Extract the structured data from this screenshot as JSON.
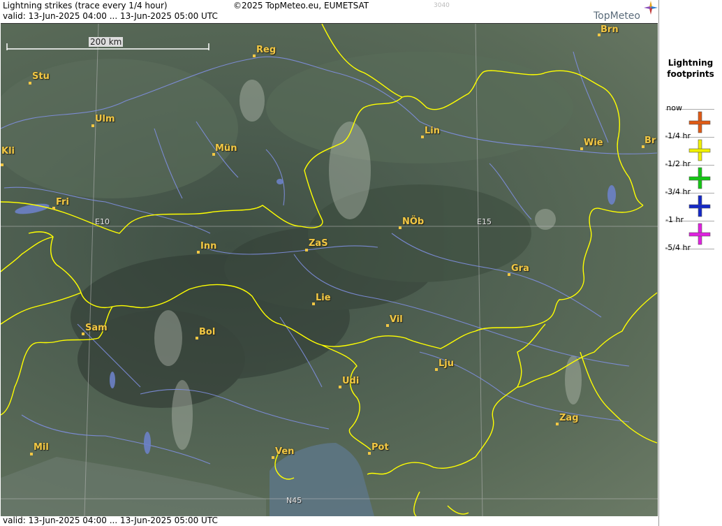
{
  "header": {
    "title": "Lightning strikes (trace every 1/4 hour)",
    "copyright": "©2025 TopMeteo.eu, EUMETSAT",
    "code": "3040",
    "valid": "valid:  13-Jun-2025 04:00 ... 13-Jun-2025 05:00 UTC",
    "logo_text": "TopMeteo"
  },
  "footer": {
    "valid": "valid:  13-Jun-2025 04:00 ... 13-Jun-2025 05:00 UTC"
  },
  "map": {
    "scale_label": "200 km",
    "grid_labels": {
      "e10": "E10",
      "e15": "E15",
      "n45": "N45"
    },
    "cities": [
      {
        "name": "Brn"
      },
      {
        "name": "Reg"
      },
      {
        "name": "Stu"
      },
      {
        "name": "Ulm"
      },
      {
        "name": "Lin"
      },
      {
        "name": "Wie"
      },
      {
        "name": "Br"
      },
      {
        "name": "Kli"
      },
      {
        "name": "Mün"
      },
      {
        "name": "Fri"
      },
      {
        "name": "NÖb"
      },
      {
        "name": "Inn"
      },
      {
        "name": "ZaS"
      },
      {
        "name": "Gra"
      },
      {
        "name": "Lie"
      },
      {
        "name": "Vil"
      },
      {
        "name": "Sam"
      },
      {
        "name": "Bol"
      },
      {
        "name": "Lju"
      },
      {
        "name": "Udi"
      },
      {
        "name": "Zag"
      },
      {
        "name": "Mil"
      },
      {
        "name": "Ven"
      },
      {
        "name": "Pot"
      }
    ],
    "colors": {
      "border": "#ffff00",
      "river": "#7f8fe0",
      "city": "#f2c744",
      "grid": "#bbbbbb"
    }
  },
  "legend": {
    "title": "Lightning footprints",
    "items": [
      {
        "label": "now",
        "color": "#e05a14"
      },
      {
        "label": "-1/4 hr",
        "color": "#f0f000"
      },
      {
        "label": "-1/2 hr",
        "color": "#14c814"
      },
      {
        "label": "-3/4 hr",
        "color": "#1428c8"
      },
      {
        "label": "-1 hr",
        "color": "#e020e0"
      },
      {
        "label": "-5/4 hr",
        "color": null
      }
    ]
  }
}
